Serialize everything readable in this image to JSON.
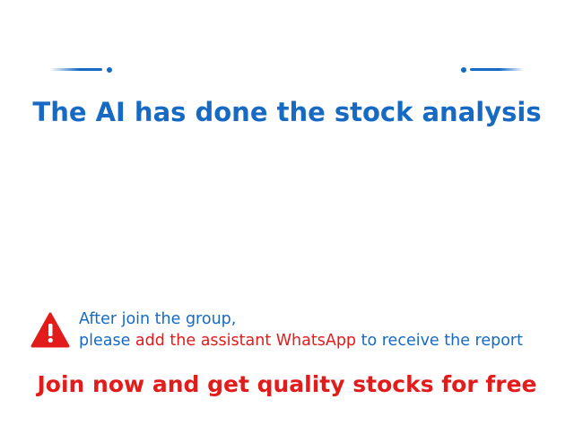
{
  "headline": "The AI has done the stock analysis",
  "notice": {
    "line1": "After join the group,",
    "line2_prefix": "please ",
    "line2_highlight": "add the assistant WhatsApp",
    "line2_suffix": " to receive the report"
  },
  "cta": "Join now and get quality stocks for free",
  "colors": {
    "primary_blue": "#176ac4",
    "highlight_red": "#e21b1b",
    "background": "#ffffff"
  },
  "icons": {
    "warning": "warning-triangle-icon",
    "ornament": "dash-dot-ornament"
  }
}
